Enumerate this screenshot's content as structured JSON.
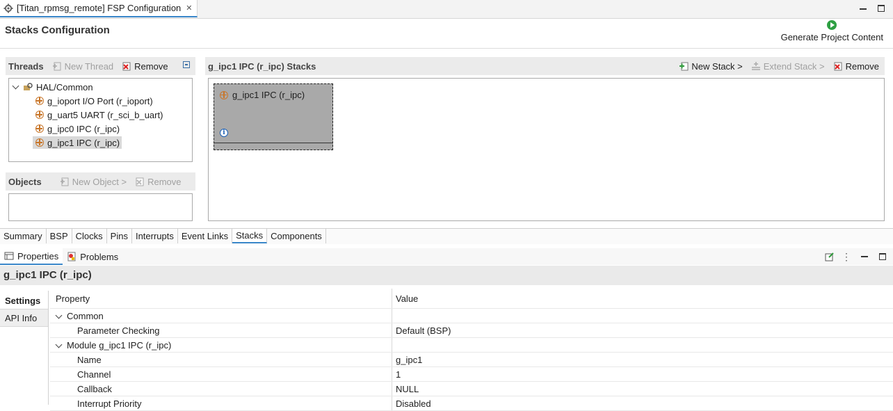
{
  "editor_tab": {
    "title": "[Titan_rpmsg_remote] FSP Configuration",
    "close": "✕"
  },
  "header": {
    "title": "Stacks Configuration",
    "generate_label": "Generate Project Content"
  },
  "threads": {
    "title": "Threads",
    "new_thread": "New Thread",
    "remove": "Remove",
    "root": "HAL/Common",
    "items": [
      "g_ioport I/O Port (r_ioport)",
      "g_uart5 UART (r_sci_b_uart)",
      "g_ipc0 IPC (r_ipc)",
      "g_ipc1 IPC (r_ipc)"
    ]
  },
  "objects": {
    "title": "Objects",
    "new_object": "New Object >",
    "remove": "Remove"
  },
  "stacks": {
    "title": "g_ipc1 IPC (r_ipc) Stacks",
    "new_stack": "New Stack >",
    "extend_stack": "Extend Stack >",
    "remove": "Remove",
    "card_label": "g_ipc1 IPC (r_ipc)"
  },
  "bottom_tabs": [
    "Summary",
    "BSP",
    "Clocks",
    "Pins",
    "Interrupts",
    "Event Links",
    "Stacks",
    "Components"
  ],
  "properties_view": {
    "tab_properties": "Properties",
    "tab_problems": "Problems",
    "title": "g_ipc1 IPC (r_ipc)",
    "side_tabs": [
      "Settings",
      "API Info"
    ],
    "col_property": "Property",
    "col_value": "Value",
    "rows": [
      {
        "group": "Common"
      },
      {
        "name": "Parameter Checking",
        "value": "Default (BSP)"
      },
      {
        "group": "Module g_ipc1 IPC (r_ipc)"
      },
      {
        "name": "Name",
        "value": "g_ipc1"
      },
      {
        "name": "Channel",
        "value": "1"
      },
      {
        "name": "Callback",
        "value": "NULL"
      },
      {
        "name": "Interrupt Priority",
        "value": "Disabled"
      }
    ]
  },
  "colors": {
    "accent": "#3a87c9",
    "card": "#a9a9a9",
    "play": "#2ea043"
  }
}
